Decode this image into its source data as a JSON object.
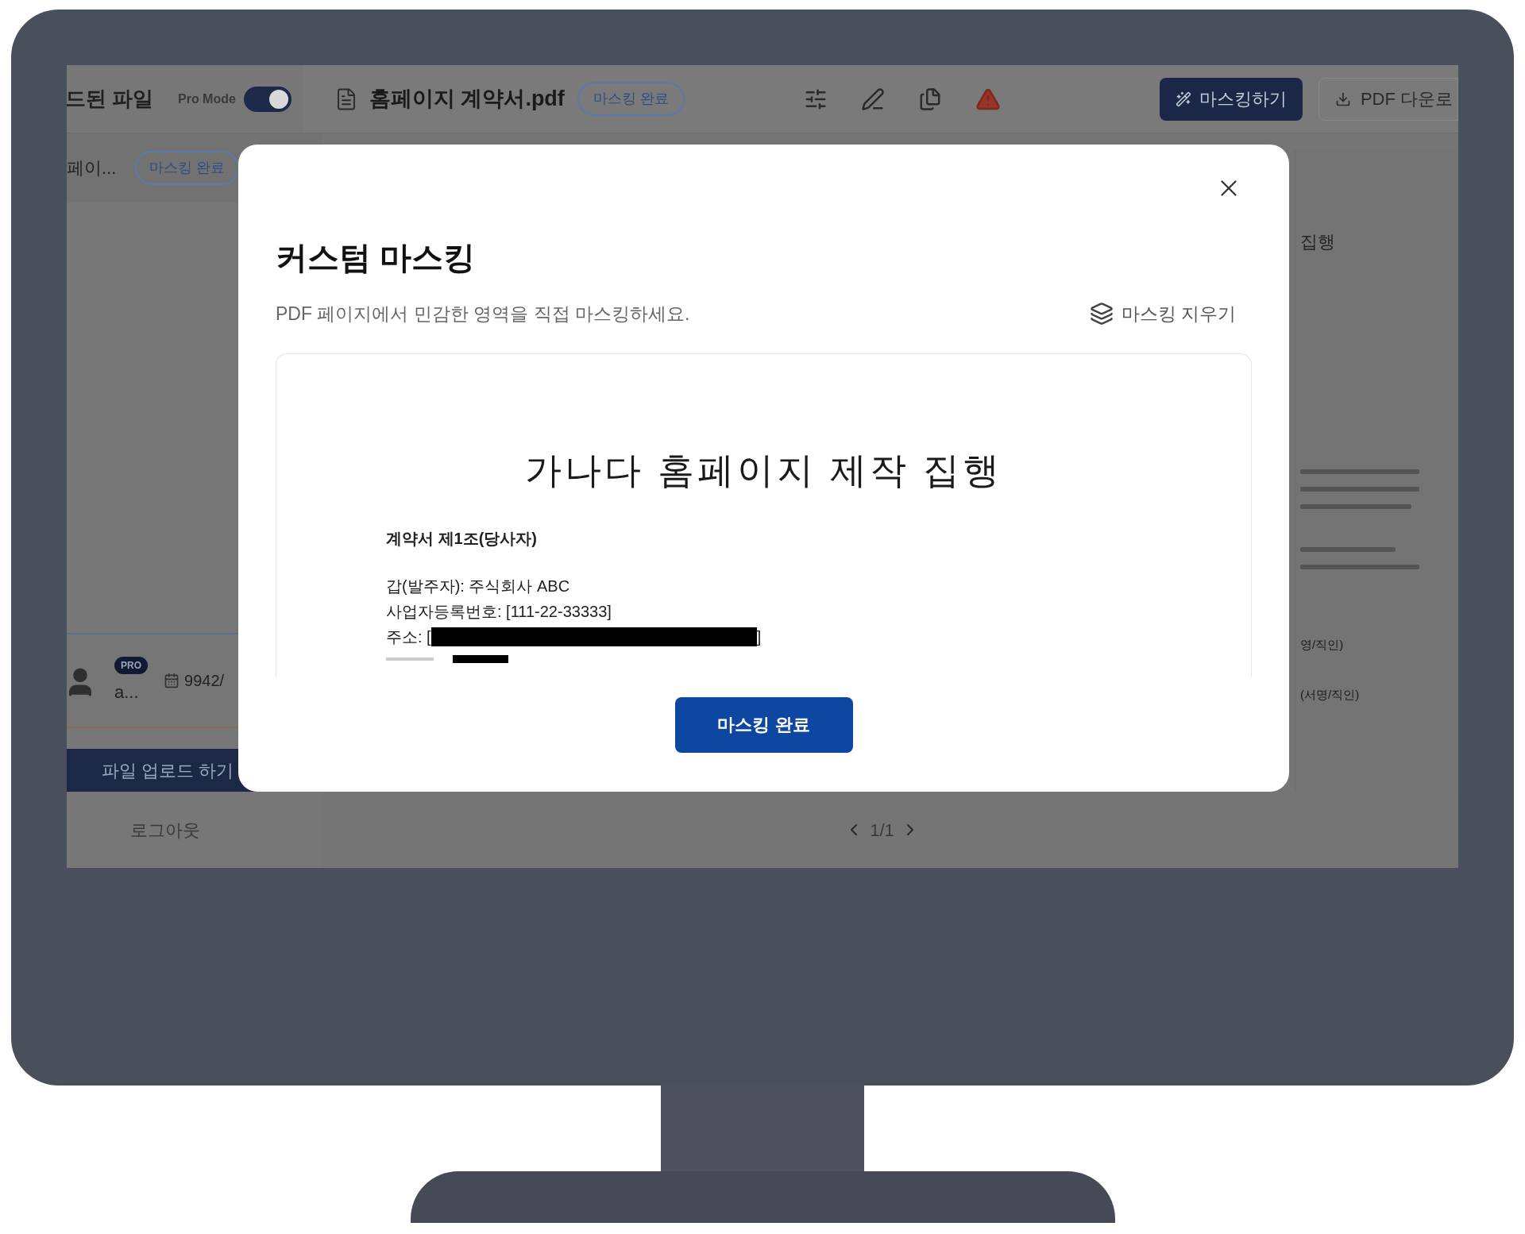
{
  "sidebar": {
    "header": "드된 파일",
    "pro_mode": {
      "label": "Pro Mode",
      "on": true
    },
    "files": [
      {
        "name": "페이...",
        "badge": "마스킹 완료"
      }
    ],
    "user": {
      "badge": "PRO",
      "name": "a...",
      "usage": "9942/"
    },
    "upload_button": "파일 업로드 하기",
    "logout": "로그아웃"
  },
  "toolbar": {
    "file_name": "홈페이지 계약서.pdf",
    "status_badge": "마스킹 완료",
    "primary_button": "마스킹하기",
    "download_button": "PDF 다운로"
  },
  "background_page": {
    "title": "집행",
    "signatures": [
      "영/직인)",
      "(서명/직인)"
    ]
  },
  "pagination": {
    "page": "1/1"
  },
  "modal": {
    "title": "커스텀 마스킹",
    "description": "PDF 페이지에서 민감한 영역을 직접 마스킹하세요.",
    "clear_button": "마스킹 지우기",
    "document": {
      "title": "가나다 홈페이지 제작 집행",
      "lines": [
        {
          "kind": "heading",
          "text": "계약서 제1조(당사자)"
        },
        {
          "kind": "text",
          "text": "갑(발주자): 주식회사 ABC"
        },
        {
          "kind": "text",
          "text": "사업자등록번호: [111-22-33333]"
        },
        {
          "kind": "masked",
          "text": "주소: [",
          "end": "]"
        }
      ]
    },
    "confirm_button": "마스킹 완료"
  }
}
